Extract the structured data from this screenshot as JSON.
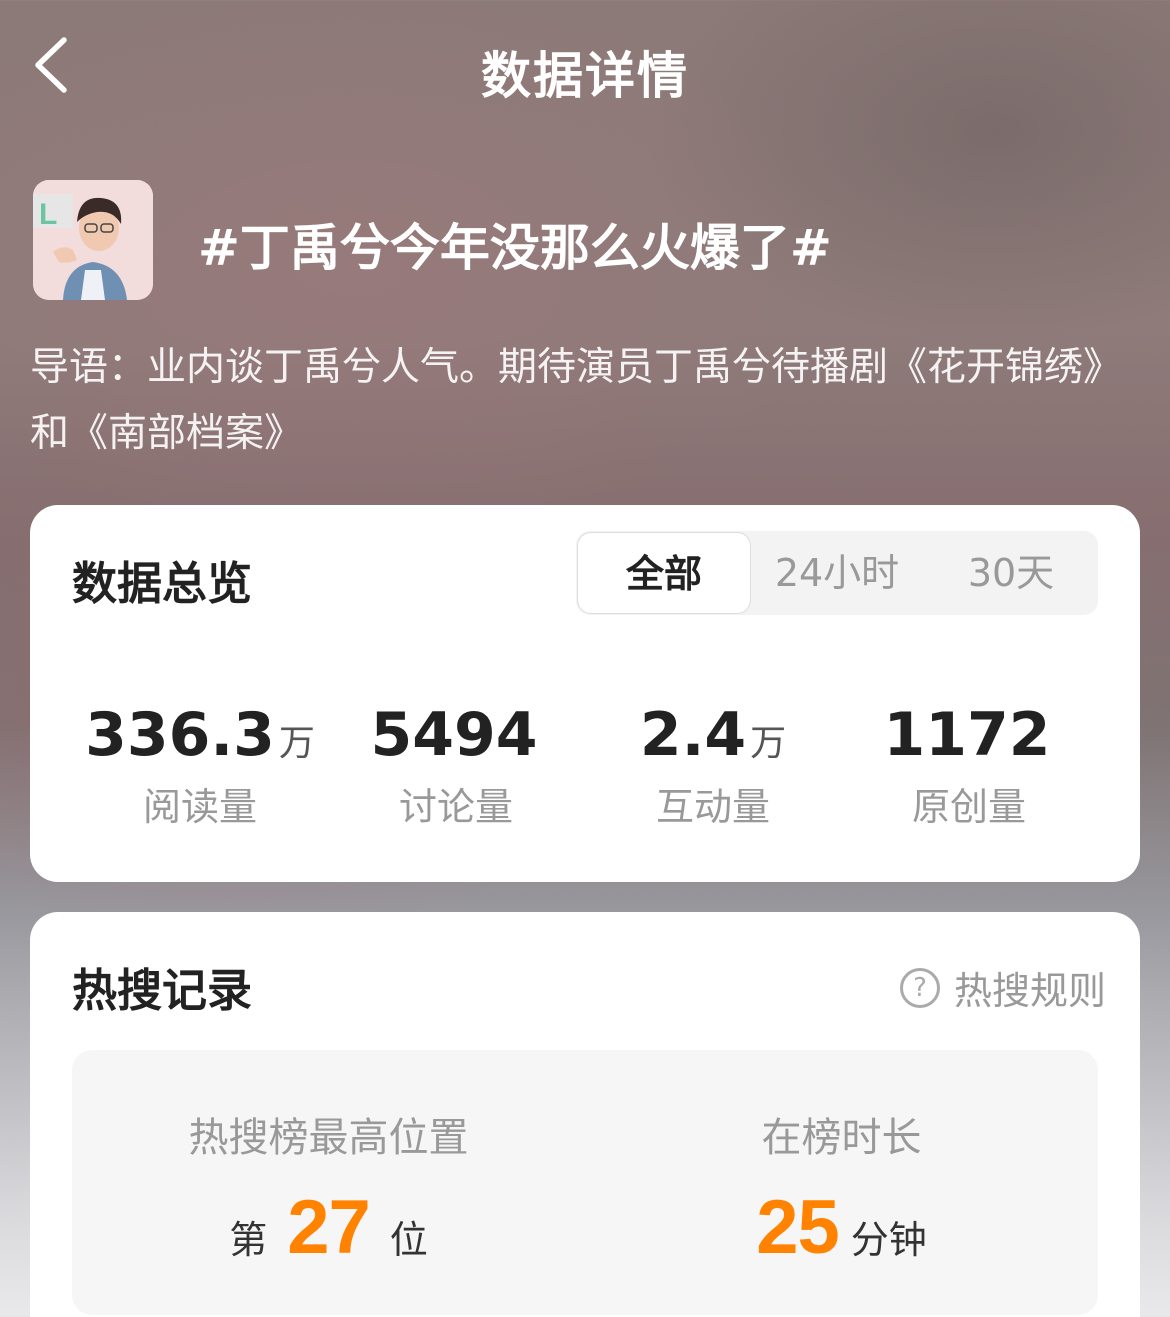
{
  "header": {
    "title": "数据详情"
  },
  "topic": {
    "title": "#丁禹兮今年没那么火爆了#",
    "intro": "导语：业内谈丁禹兮人气。期待演员丁禹兮待播剧《花开锦绣》和《南部档案》"
  },
  "overview": {
    "title": "数据总览",
    "tabs": [
      {
        "label": "全部",
        "active": true
      },
      {
        "label": "24小时",
        "active": false
      },
      {
        "label": "30天",
        "active": false
      }
    ],
    "stats": [
      {
        "value": "336.3",
        "unit": "万",
        "label": "阅读量"
      },
      {
        "value": "5494",
        "unit": "",
        "label": "讨论量"
      },
      {
        "value": "2.4",
        "unit": "万",
        "label": "互动量"
      },
      {
        "value": "1172",
        "unit": "",
        "label": "原创量"
      }
    ]
  },
  "hot": {
    "title": "热搜记录",
    "rules_label": "热搜规则",
    "rules_icon": "question-circle-icon",
    "peak": {
      "label": "热搜榜最高位置",
      "prefix": "第",
      "value": "27",
      "suffix": "位"
    },
    "duration": {
      "label": "在榜时长",
      "value": "25",
      "suffix": "分钟"
    }
  },
  "colors": {
    "accent": "#ff8200",
    "card_bg": "#ffffff"
  }
}
